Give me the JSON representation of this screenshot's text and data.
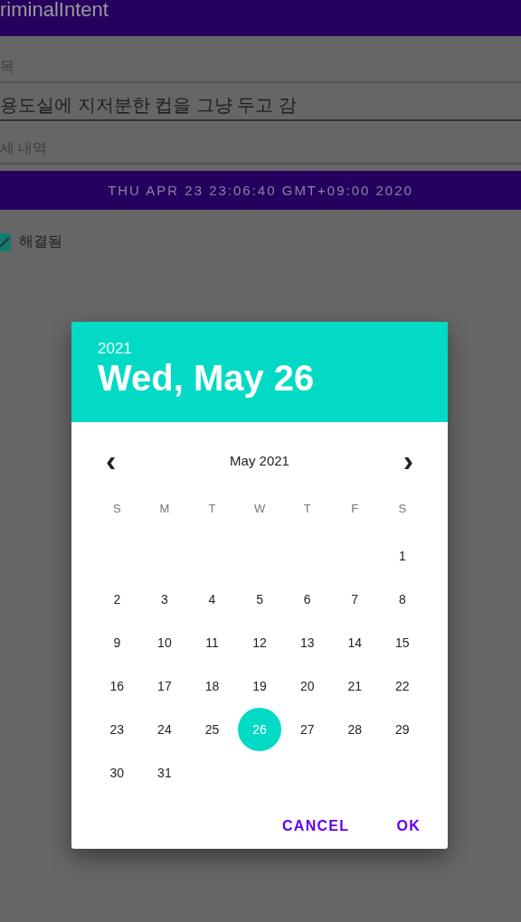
{
  "app_bar": {
    "title": "riminalIntent"
  },
  "form": {
    "title_label": "목",
    "title_value": "용도실에 지저분한 컵을 그냥 두고 감",
    "details_label": "세 내역",
    "date_button": "THU APR 23 23:06:40 GMT+09:00 2020",
    "solved": {
      "label": "해결됨",
      "checked": true
    }
  },
  "dialog": {
    "year": "2021",
    "date": "Wed, May 26",
    "month": "May 2021",
    "prev": "‹",
    "next": "›",
    "weekdays": [
      "S",
      "M",
      "T",
      "W",
      "T",
      "F",
      "S"
    ],
    "weeks": [
      [
        {
          "kind": "blank"
        },
        {
          "kind": "blank"
        },
        {
          "kind": "blank"
        },
        {
          "kind": "blank"
        },
        {
          "kind": "blank"
        },
        {
          "kind": "blank"
        },
        {
          "kind": "day",
          "label": "1",
          "selected": false
        }
      ],
      [
        {
          "label": "2",
          "selected": false
        },
        {
          "label": "3",
          "selected": false
        },
        {
          "label": "4",
          "selected": false
        },
        {
          "label": "5",
          "selected": false
        },
        {
          "label": "6",
          "selected": false
        },
        {
          "label": "7",
          "selected": false
        },
        {
          "label": "8",
          "selected": false
        }
      ],
      [
        {
          "label": "9",
          "selected": false
        },
        {
          "label": "10",
          "selected": false
        },
        {
          "label": "11",
          "selected": false
        },
        {
          "label": "12",
          "selected": false
        },
        {
          "label": "13",
          "selected": false
        },
        {
          "label": "14",
          "selected": false
        },
        {
          "label": "15",
          "selected": false
        }
      ],
      [
        {
          "label": "16",
          "selected": false
        },
        {
          "label": "17",
          "selected": false
        },
        {
          "label": "18",
          "selected": false
        },
        {
          "label": "19",
          "selected": false
        },
        {
          "label": "20",
          "selected": false
        },
        {
          "label": "21",
          "selected": false
        },
        {
          "label": "22",
          "selected": false
        }
      ],
      [
        {
          "label": "23",
          "selected": false
        },
        {
          "label": "24",
          "selected": false
        },
        {
          "label": "25",
          "selected": false
        },
        {
          "label": "26",
          "selected": true
        },
        {
          "label": "27",
          "selected": false
        },
        {
          "label": "28",
          "selected": false
        },
        {
          "label": "29",
          "selected": false
        }
      ],
      [
        {
          "label": "30",
          "selected": false
        },
        {
          "label": "31",
          "selected": false
        }
      ]
    ],
    "buttons": [
      "CANCEL",
      "OK"
    ]
  }
}
